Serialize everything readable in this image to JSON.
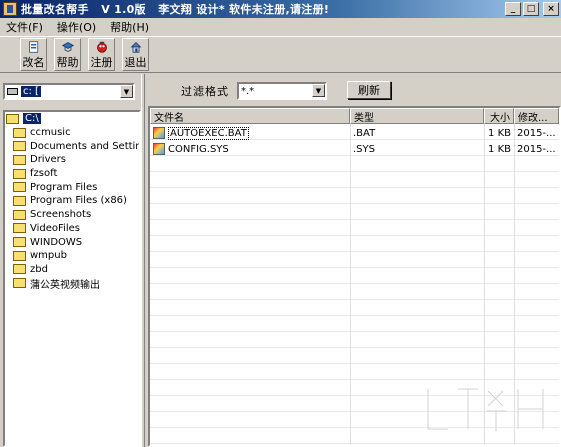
{
  "window": {
    "title": "批量改名帮手   V 1.0版   李文翔 设计* 软件未注册,请注册!",
    "caption_buttons": {
      "minimize": "_",
      "maximize": "□",
      "close": "×"
    }
  },
  "menu": [
    {
      "label": "文件(F)"
    },
    {
      "label": "操作(O)"
    },
    {
      "label": "帮助(H)"
    }
  ],
  "toolbar": {
    "buttons": [
      {
        "label": "改名",
        "icon": "rename-icon"
      },
      {
        "label": "帮助",
        "icon": "help-icon"
      },
      {
        "label": "注册",
        "icon": "register-icon"
      },
      {
        "label": "退出",
        "icon": "exit-icon"
      }
    ]
  },
  "left": {
    "drive_value": "c: [",
    "tree_root": "C:\\",
    "folders": [
      "ccmusic",
      "Documents and Settings",
      "Drivers",
      "fzsoft",
      "Program Files",
      "Program Files (x86)",
      "Screenshots",
      "VideoFiles",
      "WINDOWS",
      "wmpub",
      "zbd",
      "蒲公英视频输出"
    ]
  },
  "right": {
    "filter_label": "过滤格式",
    "filter_value": "*.*",
    "refresh_label": "刷新",
    "columns": {
      "name": "文件名",
      "type": "类型",
      "size": "大小",
      "modified": "修改..."
    },
    "files": [
      {
        "name": "AUTOEXEC.BAT",
        "type": ".BAT",
        "size": "1 KB",
        "modified": "2015-..."
      },
      {
        "name": "CONFIG.SYS",
        "type": ".SYS",
        "size": "1 KB",
        "modified": "2015-..."
      }
    ]
  },
  "colors": {
    "titlebar_start": "#0a246a",
    "titlebar_end": "#a6caf0",
    "face": "#d4d0c8",
    "selection": "#0a246a"
  }
}
